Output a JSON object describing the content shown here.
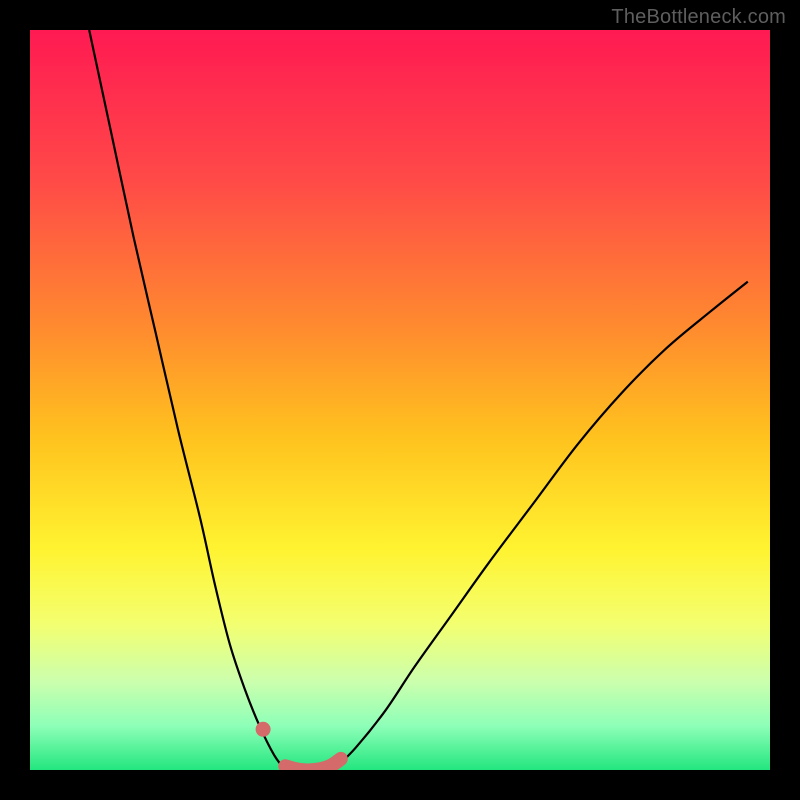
{
  "watermark": "TheBottleneck.com",
  "chart_data": {
    "type": "line",
    "title": "",
    "xlabel": "",
    "ylabel": "",
    "xlim": [
      0,
      100
    ],
    "ylim": [
      0,
      100
    ],
    "grid": false,
    "legend": false,
    "annotations": [],
    "background_gradient": {
      "stops": [
        {
          "t": 0.0,
          "color": "#ff1a52"
        },
        {
          "t": 0.2,
          "color": "#ff4948"
        },
        {
          "t": 0.4,
          "color": "#ff8a2f"
        },
        {
          "t": 0.55,
          "color": "#ffc21e"
        },
        {
          "t": 0.7,
          "color": "#fff330"
        },
        {
          "t": 0.8,
          "color": "#f4ff6e"
        },
        {
          "t": 0.88,
          "color": "#ccffad"
        },
        {
          "t": 0.94,
          "color": "#8effb8"
        },
        {
          "t": 1.0,
          "color": "#23e67f"
        }
      ]
    },
    "series": [
      {
        "name": "left-curve",
        "type": "line",
        "x": [
          8,
          11,
          14,
          17,
          20,
          23,
          25,
          27,
          29,
          31,
          33,
          34.5
        ],
        "values": [
          100,
          86,
          72,
          59,
          46,
          34,
          25,
          17,
          11,
          6,
          2,
          0
        ]
      },
      {
        "name": "right-curve",
        "type": "line",
        "x": [
          41,
          44,
          48,
          52,
          57,
          62,
          68,
          74,
          80,
          86,
          92,
          97
        ],
        "values": [
          0,
          3,
          8,
          14,
          21,
          28,
          36,
          44,
          51,
          57,
          62,
          66
        ]
      },
      {
        "name": "valley-marker",
        "type": "scatter",
        "x": [
          31.5,
          34.5,
          36.5,
          38.5,
          40.5,
          42
        ],
        "values": [
          5.5,
          0.5,
          0,
          0,
          0.5,
          1.5
        ]
      }
    ]
  }
}
